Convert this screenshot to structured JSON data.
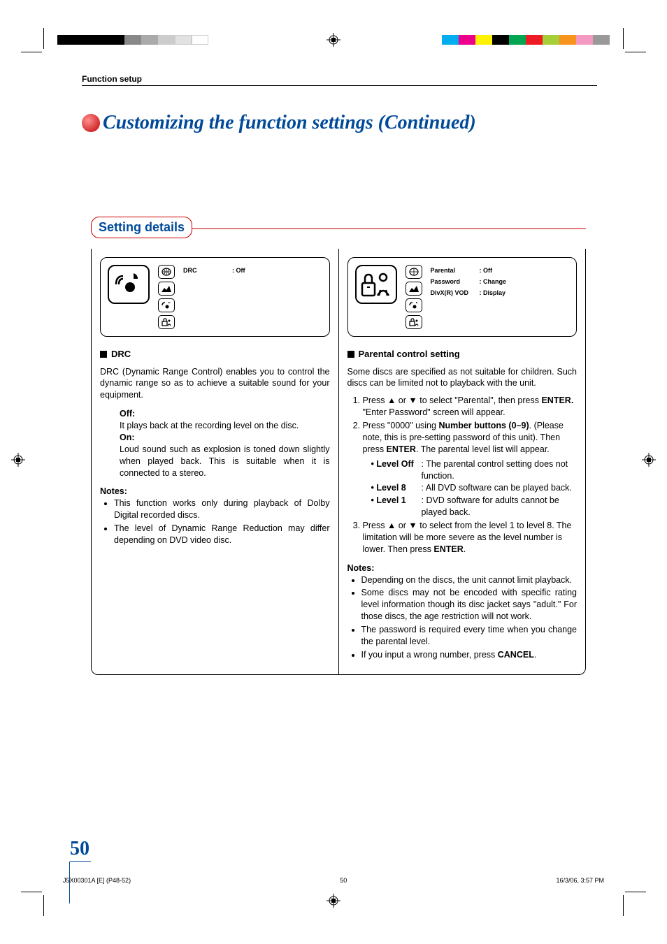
{
  "header": {
    "section": "Function setup",
    "title": "Customizing the function settings (Continued)",
    "setting_details": "Setting details"
  },
  "left": {
    "ui": {
      "drc_label": "DRC",
      "drc_value": ": Off"
    },
    "h": "DRC",
    "intro": "DRC (Dynamic Range Control) enables you to control the dynamic range so as to achieve a suitable sound for your equipment.",
    "off_h": "Off:",
    "off": "It plays back at the recording level on the disc.",
    "on_h": "On:",
    "on": "Loud sound such as explosion is toned down slightly when played back. This is suitable when it is connected to a stereo.",
    "notes_h": "Notes:",
    "notes": [
      "This function works only during playback of Dolby Digital recorded discs.",
      "The level of Dynamic Range Reduction may differ depending on DVD video disc."
    ]
  },
  "right": {
    "ui": {
      "parental_label": "Parental",
      "parental_value": ": Off",
      "password_label": "Password",
      "password_value": ": Change",
      "divx_label": "DivX(R) VOD",
      "divx_value": ": Display"
    },
    "h": "Parental control setting",
    "intro": "Some discs are specified as not suitable for children. Such discs can be limited not to playback with the unit.",
    "step1_a": "Press ",
    "step1_b": " or ",
    "step1_c": " to select \"Parental\", then press ",
    "step1_d": "ENTER.",
    "step1_e": " \"Enter Password\" screen will appear.",
    "step2_a": "Press \"0000\" using ",
    "step2_b": "Number buttons (0–9)",
    "step2_c": ". (Please note, this is pre-setting password of this unit). Then press ",
    "step2_d": "ENTER",
    "step2_e": ". The parental level list will appear.",
    "lvloff_k": "• Level Off",
    "lvloff_v": ": The parental control setting does not function.",
    "lvl8_k": "• Level 8",
    "lvl8_v": ": All DVD software can be played back.",
    "lvl1_k": "• Level 1",
    "lvl1_v": ": DVD software for adults cannot be played back.",
    "step3_a": "Press ",
    "step3_b": " or ",
    "step3_c": " to select from the level 1 to level 8. The limitation will be more severe as the level number is lower. Then press ",
    "step3_d": "ENTER",
    "step3_e": ".",
    "notes_h": "Notes:",
    "notes": [
      "Depending on the discs, the unit cannot limit playback.",
      "Some discs may not be encoded with specific rating level information though its disc jacket says \"adult.\" For those discs, the age restriction will not work.",
      "The password is required every time when you change the parental level."
    ],
    "note_cancel_a": "If you input a wrong number, press ",
    "note_cancel_b": "CANCEL",
    "note_cancel_c": "."
  },
  "footer": {
    "left": "J5X00301A [E] (P48-52)",
    "center": "50",
    "right": "16/3/06, 3:57 PM",
    "page": "50"
  },
  "colors": {
    "left_bar": [
      "#000",
      "#000",
      "#000",
      "#000",
      "#777",
      "#aaa",
      "#ccc",
      "#e0e0e0",
      "#fff",
      "#fff"
    ],
    "right_bar": [
      "#00aeef",
      "#ec008c",
      "#fff200",
      "#000",
      "#00a651",
      "#ed1c24",
      "#a6ce39",
      "#f7941d",
      "#f49ac1",
      "#999"
    ]
  }
}
